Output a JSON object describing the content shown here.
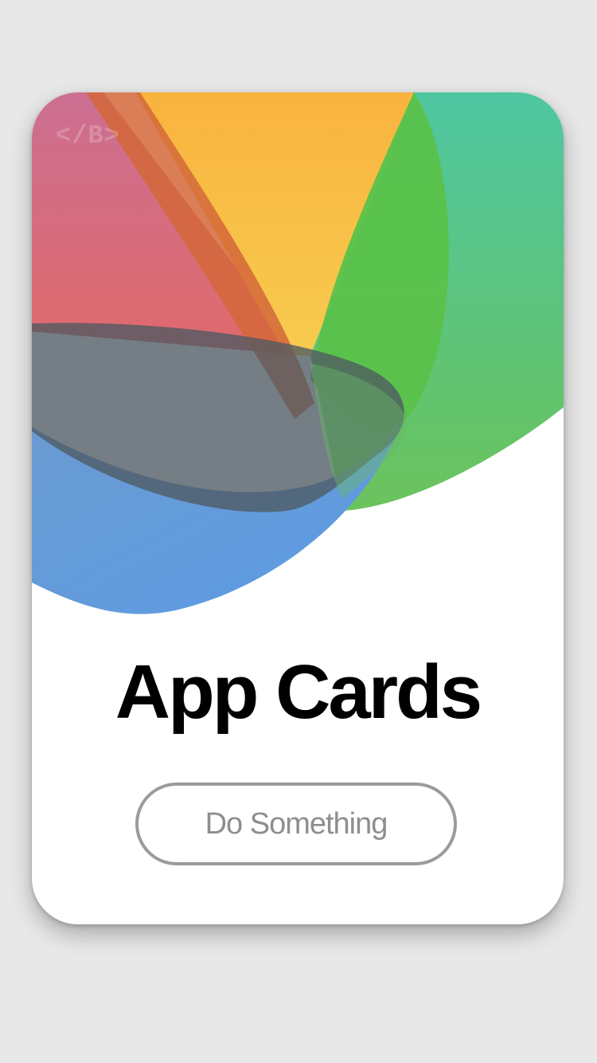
{
  "card": {
    "logo_text": "</B>",
    "title": "App Cards",
    "action_label": "Do Something"
  },
  "colors": {
    "background": "#e8e8e8",
    "card": "#ffffff",
    "pink": "#d06c94",
    "orange": "#f9b443",
    "teal": "#4ec4a0",
    "green": "#5ac24a",
    "blue": "#5f9ae2",
    "dark": "#5d6468",
    "title": "#000000",
    "button_border": "#9b9b9b",
    "button_text": "#8e8e8e"
  }
}
